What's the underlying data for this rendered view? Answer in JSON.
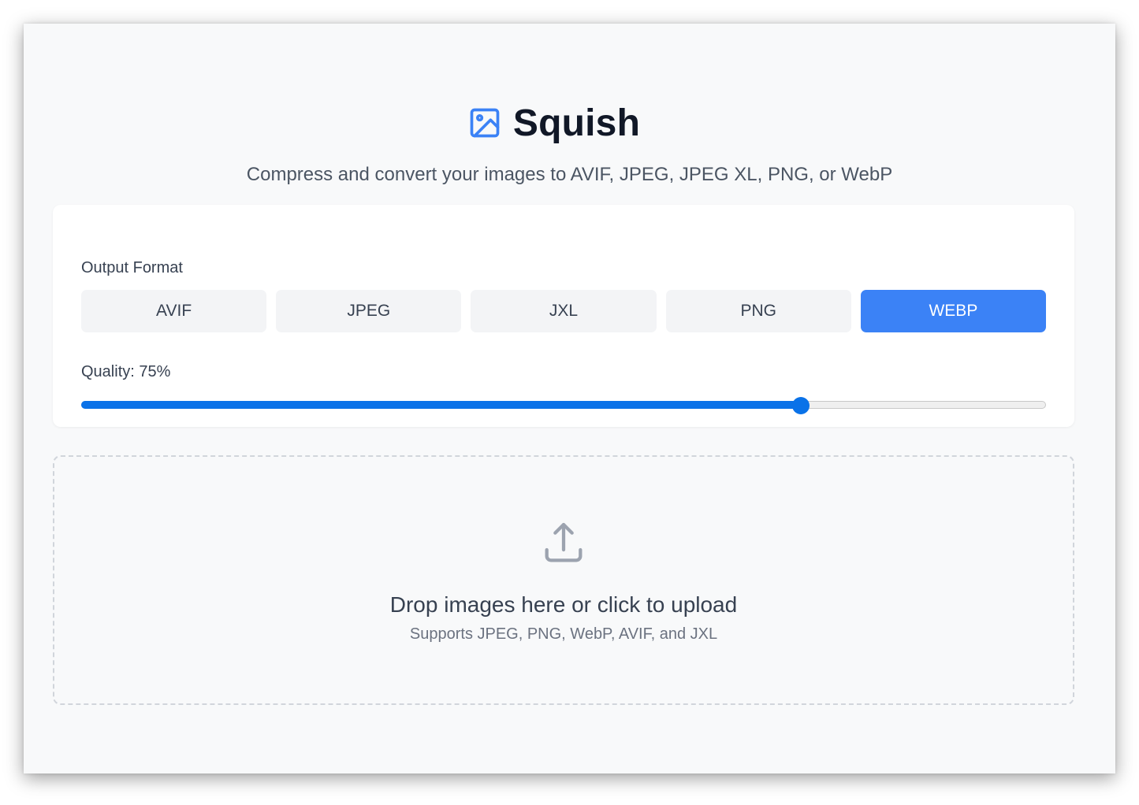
{
  "app": {
    "title": "Squish",
    "subtitle": "Compress and convert your images to AVIF, JPEG, JPEG XL, PNG, or WebP",
    "logo_icon": "image-icon"
  },
  "settings": {
    "format_label": "Output Format",
    "formats": [
      {
        "label": "AVIF",
        "selected": false
      },
      {
        "label": "JPEG",
        "selected": false
      },
      {
        "label": "JXL",
        "selected": false
      },
      {
        "label": "PNG",
        "selected": false
      },
      {
        "label": "WEBP",
        "selected": true
      }
    ],
    "quality_label": "Quality: 75%",
    "quality_value": 75,
    "quality_min": 0,
    "quality_max": 100
  },
  "dropzone": {
    "icon": "upload-icon",
    "title": "Drop images here or click to upload",
    "subtitle": "Supports JPEG, PNG, WebP, AVIF, and JXL"
  },
  "colors": {
    "accent": "#3b82f6",
    "slider": "#0a72e8",
    "background": "#f8f9fa"
  }
}
